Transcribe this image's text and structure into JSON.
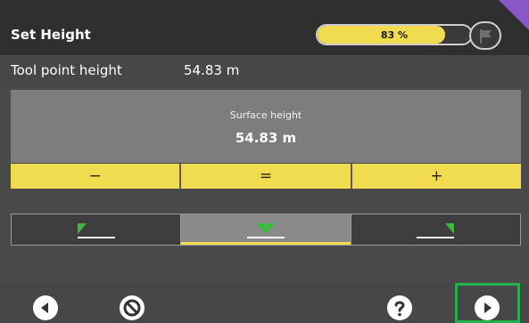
{
  "header": {
    "title": "Set Height",
    "progress": {
      "percent": 83,
      "label": "83 %"
    },
    "flag_icon": "flag-icon",
    "corner_color": "#8a57c8"
  },
  "tool_point": {
    "label": "Tool point height",
    "value": "54.83 m"
  },
  "surface": {
    "label": "Surface height",
    "value": "54.83 m"
  },
  "adjust_buttons": {
    "minus": "−",
    "equals": "=",
    "plus": "+"
  },
  "modes": [
    {
      "icon": "left-marker-icon",
      "active": false
    },
    {
      "icon": "center-marker-icon",
      "active": true
    },
    {
      "icon": "right-marker-icon",
      "active": false
    }
  ],
  "bottom": {
    "back_icon": "back-arrow-icon",
    "cancel_icon": "cancel-icon",
    "help_icon": "help-icon",
    "next_icon": "next-arrow-icon"
  },
  "colors": {
    "accent_yellow": "#f1dc4f",
    "highlight_green": "#22b24c",
    "marker_green": "#3fb83f"
  }
}
